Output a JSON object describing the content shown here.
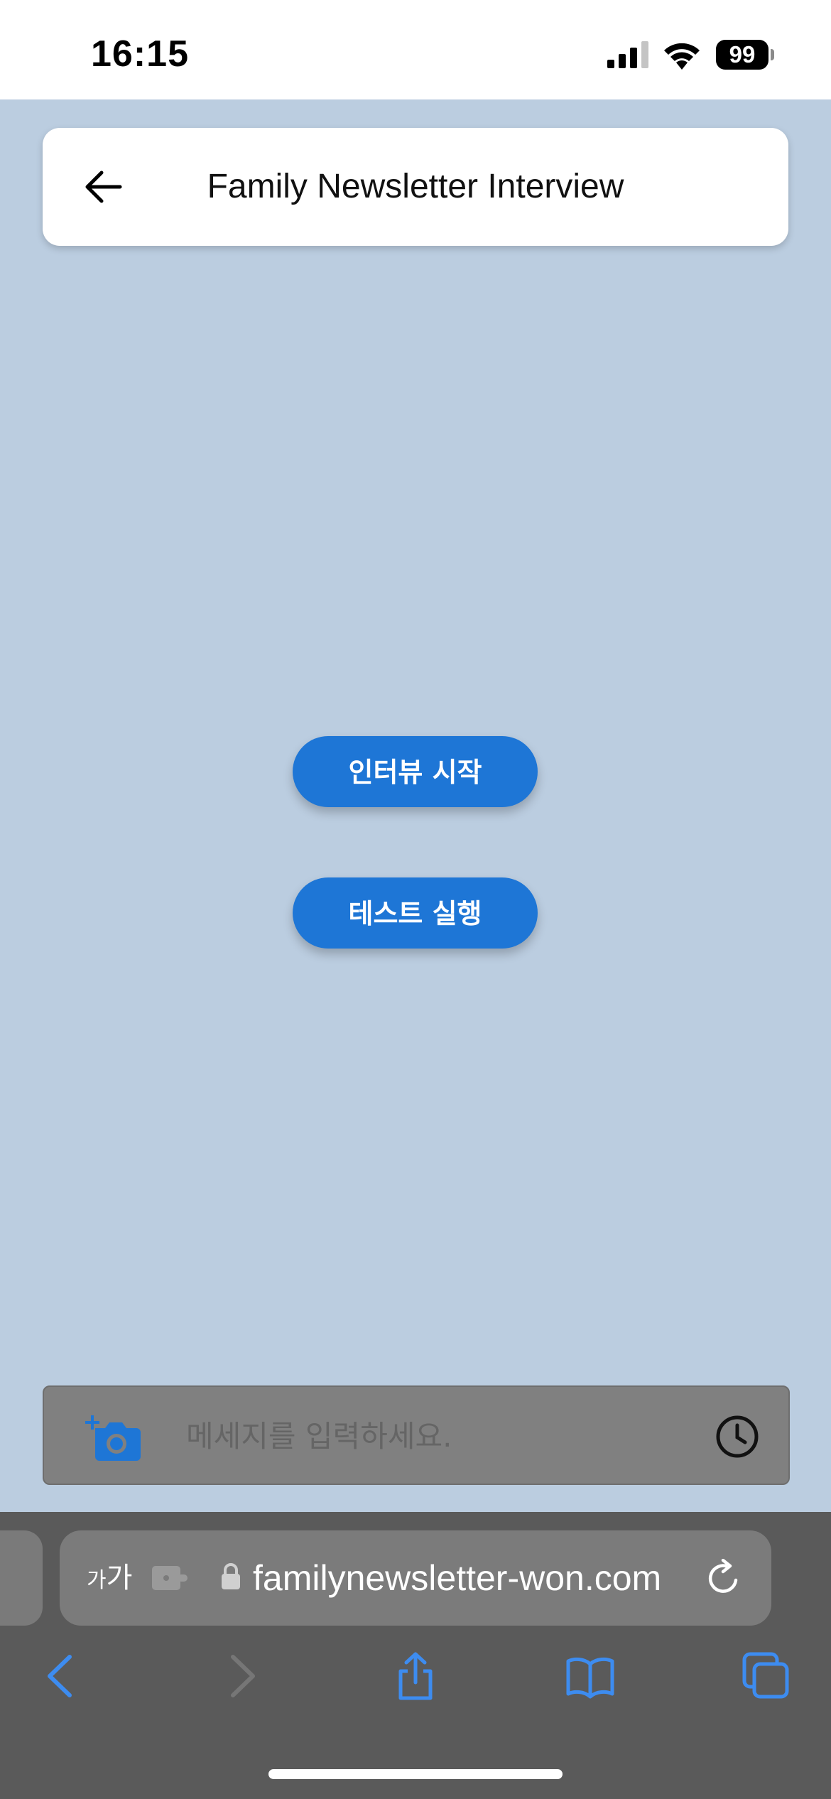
{
  "status_bar": {
    "time": "16:15",
    "battery": "99",
    "icons": [
      "signal-icon",
      "wifi-icon",
      "battery-icon"
    ]
  },
  "header": {
    "title": "Family Newsletter Interview",
    "back_icon": "arrow-left-icon"
  },
  "main": {
    "start_interview_label": "인터뷰 시작",
    "run_test_label": "테스트 실행"
  },
  "composer": {
    "placeholder": "메세지를 입력하세요.",
    "camera_icon": "add-photo-camera-icon",
    "clock_icon": "clock-icon",
    "disabled": true
  },
  "browser": {
    "aa_small": "가",
    "aa_large": "가",
    "url": "familynewsletter-won.com",
    "toolbar_icons": [
      "back-arrow-icon",
      "forward-arrow-icon",
      "share-icon",
      "bookmarks-icon",
      "tabs-icon"
    ]
  },
  "colors": {
    "page_background": "#bbcde0",
    "accent": "#1e76d6",
    "chrome_background": "#5a5a5a"
  }
}
